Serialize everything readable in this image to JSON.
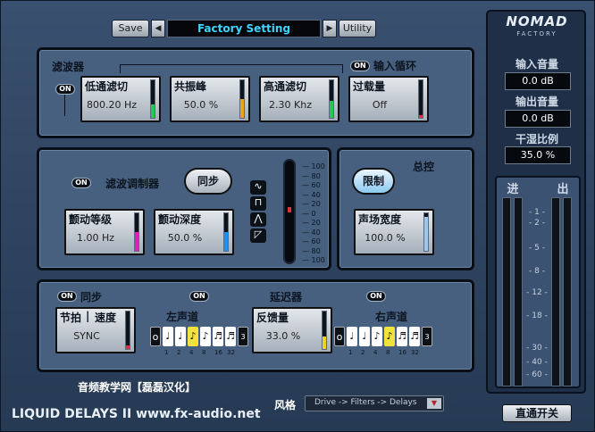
{
  "header": {
    "save_label": "Save",
    "preset": "Factory Setting",
    "utility_label": "Utility",
    "prev": "◀",
    "next": "▶"
  },
  "brand": {
    "logo_top": "NOMAD",
    "logo_bottom": "FACTORY"
  },
  "filter": {
    "title": "滤波器",
    "loop_toggle": "ON",
    "loop_label": "输入循环",
    "on_toggle": "ON",
    "lowcut": {
      "label": "低通滤切",
      "value": "800.20 Hz",
      "level": 0.35,
      "color": "#1fcc4a"
    },
    "resonance": {
      "label": "共振峰",
      "value": "50.0 %",
      "level": 0.5,
      "color": "#f0a020"
    },
    "highcut": {
      "label": "高通滤切",
      "value": "2.30 Khz",
      "level": 0.45,
      "color": "#1fcc4a"
    },
    "overload": {
      "label": "过载量",
      "value": "Off",
      "level": 0.08,
      "color": "#e03040"
    }
  },
  "modulator": {
    "on_toggle": "ON",
    "title": "滤波调制器",
    "sync_label": "同步",
    "rate": {
      "label": "颤动等级",
      "value": "1.00 Hz",
      "level": 0.5,
      "color": "#e020c0"
    },
    "depth": {
      "label": "颤动深度",
      "value": "50.0 %",
      "level": 0.5,
      "color": "#2090f0"
    },
    "scale": [
      "100",
      "80",
      "60",
      "40",
      "20",
      "0",
      "20",
      "40",
      "60",
      "80",
      "100"
    ],
    "waves": [
      "∿",
      "⊓",
      "⋀",
      "◸"
    ]
  },
  "master": {
    "title": "总控",
    "limit_label": "限制",
    "width": {
      "label": "声场宽度",
      "value": "100.0 %",
      "level": 0.9,
      "color": "#9cc8f0"
    }
  },
  "delay": {
    "sync_toggle": "ON",
    "sync_label": "同步",
    "beat_label": "节拍",
    "speed_label": "速度",
    "sync_value": "SYNC",
    "sync_level": 0.1,
    "sync_color": "#e03040",
    "left_toggle": "ON",
    "title": "延迟器",
    "right_toggle": "ON",
    "left_label": "左声道",
    "right_label": "右声道",
    "feedback": {
      "label": "反馈量",
      "value": "33.0 %",
      "level": 0.33,
      "color": "#f2d020"
    },
    "left_notes": [
      "o",
      "♩",
      "♩",
      "♪",
      "♪",
      "♬",
      "♬"
    ],
    "left_sel": 3,
    "right_notes": [
      "o",
      "♩",
      "♩",
      "♪",
      "♪",
      "♬",
      "♬"
    ],
    "right_sel": 4,
    "note_nums": [
      "1",
      "2",
      "4",
      "8",
      "16",
      "32"
    ],
    "dot_mark": "3"
  },
  "right": {
    "input_label": "输入音量",
    "input_value": "0.0 dB",
    "output_label": "输出音量",
    "output_value": "0.0 dB",
    "mix_label": "干湿比例",
    "mix_value": "35.0 %",
    "in_label": "进",
    "out_label": "出",
    "vu_ticks": [
      "- 1 -",
      "- 2 -",
      "- 5 -",
      "- 8 -",
      "- 12 -",
      "- 18 -",
      "- 30 -",
      "- 40 -",
      "- 60 -"
    ],
    "bypass_label": "直通开关"
  },
  "footer": {
    "credit": "音频教学网【磊磊汉化】",
    "product": "LIQUID DELAYS II www.fx-audio.net",
    "style_label": "风格",
    "style_value": "Drive -> Filters -> Delays"
  }
}
